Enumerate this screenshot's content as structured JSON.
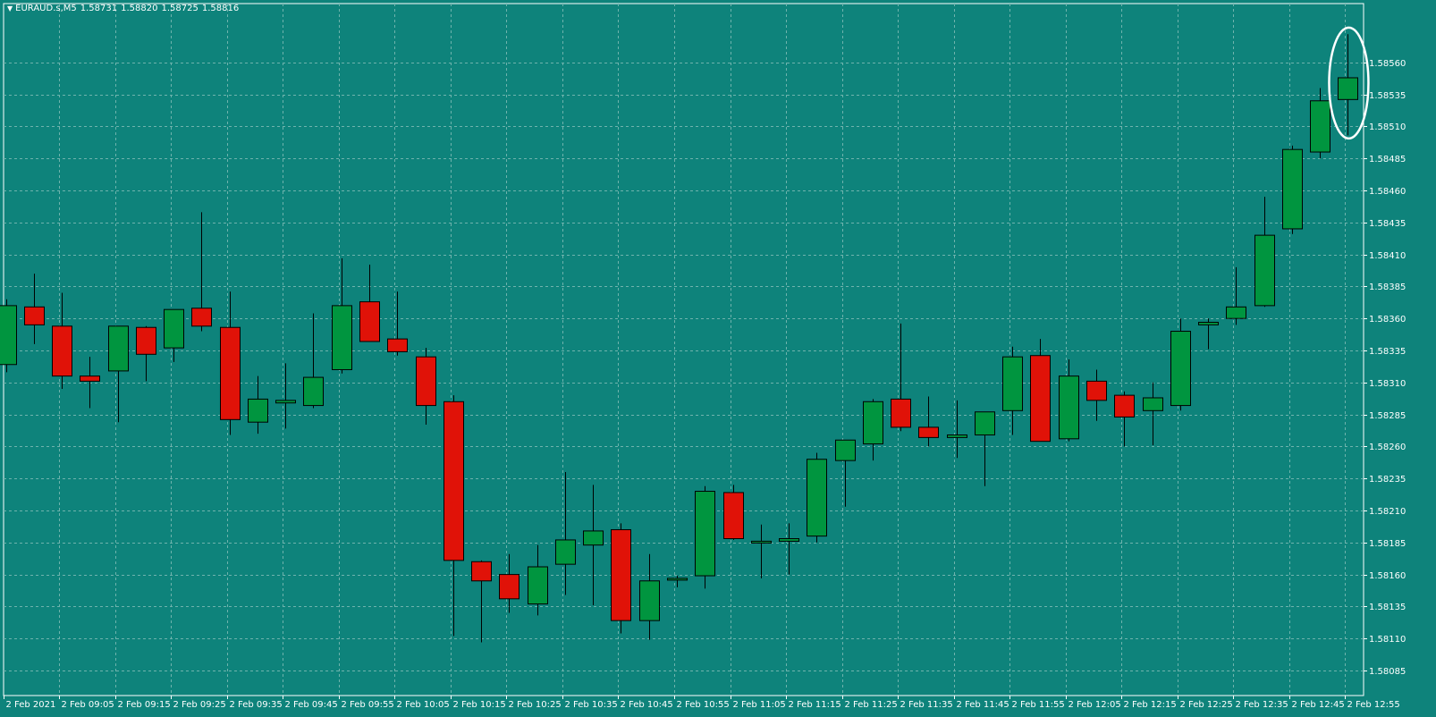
{
  "header": {
    "symbol": "EURAUD.s,M5",
    "open": "1.58731",
    "high": "1.58820",
    "low": "1.58725",
    "close": "1.58816"
  },
  "colors": {
    "background": "#0e837b",
    "grid": "#6fb3ad",
    "bull": "#00953f",
    "bear": "#e01208",
    "outline": "#000000",
    "axis_text": "#ffffff",
    "highlight": "#ffffff"
  },
  "chart_data": {
    "type": "candlestick",
    "symbol": "EURAUD.s",
    "timeframe": "M5",
    "grid": true,
    "ylim": [
      1.58085,
      1.58585
    ],
    "y_ticks": [
      "1.58560",
      "1.58535",
      "1.58510",
      "1.58485",
      "1.58460",
      "1.58435",
      "1.58410",
      "1.58385",
      "1.58360",
      "1.58335",
      "1.58310",
      "1.58285",
      "1.58260",
      "1.58235",
      "1.58210",
      "1.58185",
      "1.58160",
      "1.58135",
      "1.58110",
      "1.58085"
    ],
    "x_ticks": [
      "2 Feb 2021",
      "2 Feb 09:05",
      "2 Feb 09:15",
      "2 Feb 09:25",
      "2 Feb 09:35",
      "2 Feb 09:45",
      "2 Feb 09:55",
      "2 Feb 10:05",
      "2 Feb 10:15",
      "2 Feb 10:25",
      "2 Feb 10:35",
      "2 Feb 10:45",
      "2 Feb 10:55",
      "2 Feb 11:05",
      "2 Feb 11:15",
      "2 Feb 11:25",
      "2 Feb 11:35",
      "2 Feb 11:45",
      "2 Feb 11:55",
      "2 Feb 12:05",
      "2 Feb 12:15",
      "2 Feb 12:25",
      "2 Feb 12:35",
      "2 Feb 12:45",
      "2 Feb 12:55"
    ],
    "highlight": "last-candle",
    "candles": [
      {
        "o": 1.58324,
        "h": 1.58375,
        "l": 1.58318,
        "c": 1.5837
      },
      {
        "o": 1.58369,
        "h": 1.58395,
        "l": 1.5834,
        "c": 1.58355
      },
      {
        "o": 1.58354,
        "h": 1.5838,
        "l": 1.58305,
        "c": 1.58315
      },
      {
        "o": 1.58315,
        "h": 1.5833,
        "l": 1.5829,
        "c": 1.58311
      },
      {
        "o": 1.58319,
        "h": 1.58354,
        "l": 1.58279,
        "c": 1.58354
      },
      {
        "o": 1.58353,
        "h": 1.58354,
        "l": 1.58311,
        "c": 1.58332
      },
      {
        "o": 1.58337,
        "h": 1.58366,
        "l": 1.58326,
        "c": 1.58367
      },
      {
        "o": 1.58368,
        "h": 1.58443,
        "l": 1.5835,
        "c": 1.58354
      },
      {
        "o": 1.58353,
        "h": 1.58381,
        "l": 1.58269,
        "c": 1.58281
      },
      {
        "o": 1.58279,
        "h": 1.58315,
        "l": 1.5827,
        "c": 1.58297
      },
      {
        "o": 1.58294,
        "h": 1.58325,
        "l": 1.58274,
        "c": 1.58296
      },
      {
        "o": 1.58292,
        "h": 1.58364,
        "l": 1.5829,
        "c": 1.58314
      },
      {
        "o": 1.5832,
        "h": 1.58407,
        "l": 1.58317,
        "c": 1.5837
      },
      {
        "o": 1.58373,
        "h": 1.58402,
        "l": 1.58342,
        "c": 1.58342
      },
      {
        "o": 1.58344,
        "h": 1.58381,
        "l": 1.58331,
        "c": 1.58334
      },
      {
        "o": 1.5833,
        "h": 1.58337,
        "l": 1.58277,
        "c": 1.58292
      },
      {
        "o": 1.58295,
        "h": 1.583,
        "l": 1.58112,
        "c": 1.58171
      },
      {
        "o": 1.5817,
        "h": 1.58171,
        "l": 1.58107,
        "c": 1.58155
      },
      {
        "o": 1.5816,
        "h": 1.58176,
        "l": 1.5813,
        "c": 1.58141
      },
      {
        "o": 1.58137,
        "h": 1.58183,
        "l": 1.58128,
        "c": 1.58166
      },
      {
        "o": 1.58168,
        "h": 1.5824,
        "l": 1.58144,
        "c": 1.58187
      },
      {
        "o": 1.58183,
        "h": 1.5823,
        "l": 1.58136,
        "c": 1.58194
      },
      {
        "o": 1.58195,
        "h": 1.582,
        "l": 1.58114,
        "c": 1.58124
      },
      {
        "o": 1.58124,
        "h": 1.58176,
        "l": 1.58109,
        "c": 1.58155
      },
      {
        "o": 1.58157,
        "h": 1.58159,
        "l": 1.5815,
        "c": 1.58157
      },
      {
        "o": 1.58159,
        "h": 1.58229,
        "l": 1.58149,
        "c": 1.58225
      },
      {
        "o": 1.58224,
        "h": 1.5823,
        "l": 1.58187,
        "c": 1.58188
      },
      {
        "o": 1.58185,
        "h": 1.58199,
        "l": 1.58157,
        "c": 1.58186
      },
      {
        "o": 1.58186,
        "h": 1.582,
        "l": 1.5816,
        "c": 1.58188
      },
      {
        "o": 1.5819,
        "h": 1.58255,
        "l": 1.58185,
        "c": 1.5825
      },
      {
        "o": 1.58249,
        "h": 1.58264,
        "l": 1.58213,
        "c": 1.58265
      },
      {
        "o": 1.58262,
        "h": 1.58297,
        "l": 1.58249,
        "c": 1.58295
      },
      {
        "o": 1.58297,
        "h": 1.58356,
        "l": 1.58272,
        "c": 1.58275
      },
      {
        "o": 1.58275,
        "h": 1.58299,
        "l": 1.5826,
        "c": 1.58267
      },
      {
        "o": 1.58267,
        "h": 1.58296,
        "l": 1.58251,
        "c": 1.58269
      },
      {
        "o": 1.58269,
        "h": 1.58286,
        "l": 1.58229,
        "c": 1.58287
      },
      {
        "o": 1.58288,
        "h": 1.58338,
        "l": 1.58269,
        "c": 1.5833
      },
      {
        "o": 1.58331,
        "h": 1.58344,
        "l": 1.58264,
        "c": 1.58264
      },
      {
        "o": 1.58266,
        "h": 1.58328,
        "l": 1.58264,
        "c": 1.58315
      },
      {
        "o": 1.58311,
        "h": 1.5832,
        "l": 1.5828,
        "c": 1.58296
      },
      {
        "o": 1.583,
        "h": 1.58303,
        "l": 1.5826,
        "c": 1.58283
      },
      {
        "o": 1.58288,
        "h": 1.5831,
        "l": 1.58261,
        "c": 1.58298
      },
      {
        "o": 1.58292,
        "h": 1.5836,
        "l": 1.58288,
        "c": 1.5835
      },
      {
        "o": 1.58355,
        "h": 1.5836,
        "l": 1.58336,
        "c": 1.58357
      },
      {
        "o": 1.5836,
        "h": 1.584,
        "l": 1.58355,
        "c": 1.58369
      },
      {
        "o": 1.5837,
        "h": 1.58455,
        "l": 1.58369,
        "c": 1.58425
      },
      {
        "o": 1.5843,
        "h": 1.58495,
        "l": 1.58426,
        "c": 1.58492
      },
      {
        "o": 1.5849,
        "h": 1.5854,
        "l": 1.58485,
        "c": 1.5853
      },
      {
        "o": 1.58531,
        "h": 1.58582,
        "l": 1.58503,
        "c": 1.58548
      }
    ]
  }
}
